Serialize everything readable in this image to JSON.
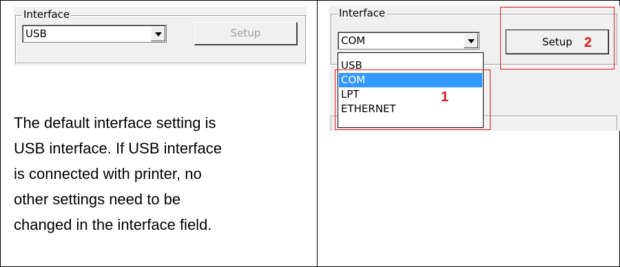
{
  "left_panel": {
    "legend": "Interface",
    "combo_value": "USB",
    "setup_label": "Setup",
    "description_lines": [
      "The default interface setting is",
      "USB interface. If USB interface",
      "is connected with printer, no",
      "other settings need to be",
      "changed in the interface field."
    ]
  },
  "right_panel": {
    "legend": "Interface",
    "combo_value": "COM",
    "setup_label": "Setup",
    "dropdown_options": [
      "USB",
      "COM",
      "LPT",
      "ETHERNET"
    ],
    "selected_option": "COM",
    "annotations": {
      "dropdown_callout": "1",
      "setup_callout": "2"
    }
  },
  "colors": {
    "highlight": "#3399ff",
    "callout": "#e8111c"
  }
}
